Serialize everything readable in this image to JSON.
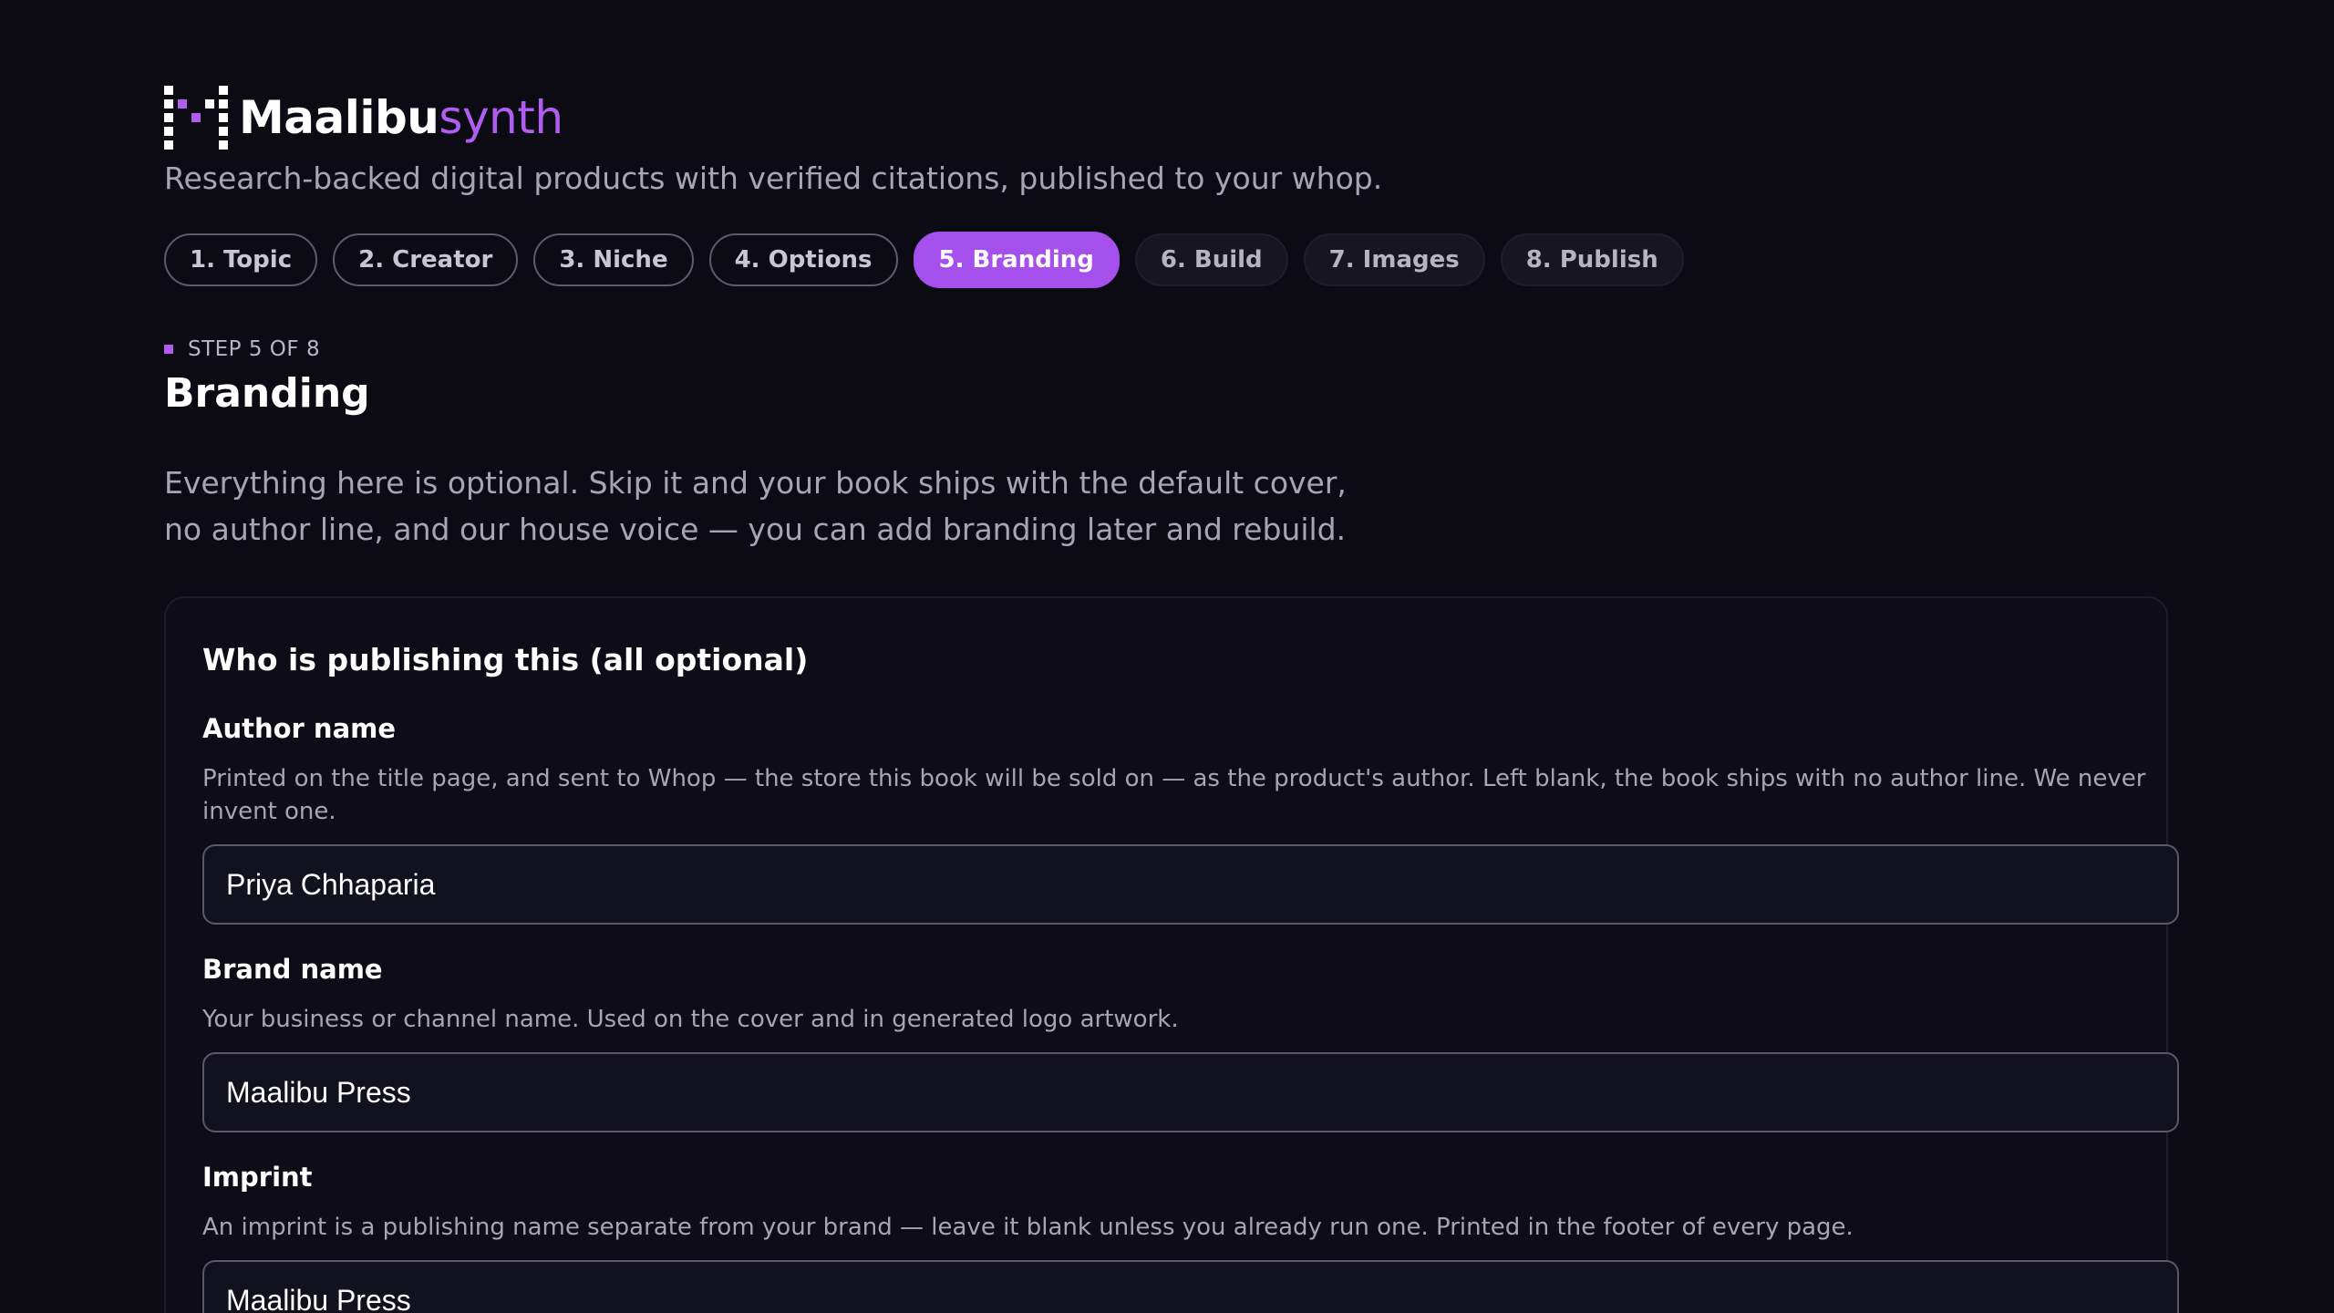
{
  "brand": {
    "name_part1": "Maalibu",
    "name_part2": "synth",
    "accent_color": "#b15ef0",
    "tagline": "Research-backed digital products with verified citations, published to your whop."
  },
  "steps": [
    {
      "label": "1. Topic",
      "state": "done"
    },
    {
      "label": "2. Creator",
      "state": "done"
    },
    {
      "label": "3. Niche",
      "state": "done"
    },
    {
      "label": "4. Options",
      "state": "done"
    },
    {
      "label": "5. Branding",
      "state": "active"
    },
    {
      "label": "6. Build",
      "state": "todo"
    },
    {
      "label": "7. Images",
      "state": "todo"
    },
    {
      "label": "8. Publish",
      "state": "todo"
    }
  ],
  "header": {
    "step_label": "STEP 5 OF 8",
    "title": "Branding",
    "intro": "Everything here is optional. Skip it and your book ships with the default cover, no author line, and our house voice — you can add branding later and rebuild."
  },
  "card": {
    "title": "Who is publishing this (all optional)",
    "fields": {
      "author": {
        "label": "Author name",
        "help": "Printed on the title page, and sent to Whop — the store this book will be sold on — as the product's author. Left blank, the book ships with no author line. We never invent one.",
        "value": "Priya Chhaparia"
      },
      "brand": {
        "label": "Brand name",
        "help": "Your business or channel name. Used on the cover and in generated logo artwork.",
        "value": "Maalibu Press"
      },
      "imprint": {
        "label": "Imprint",
        "help": "An imprint is a publishing name separate from your brand — leave it blank unless you already run one. Printed in the footer of every page.",
        "value": "Maalibu Press"
      }
    }
  }
}
